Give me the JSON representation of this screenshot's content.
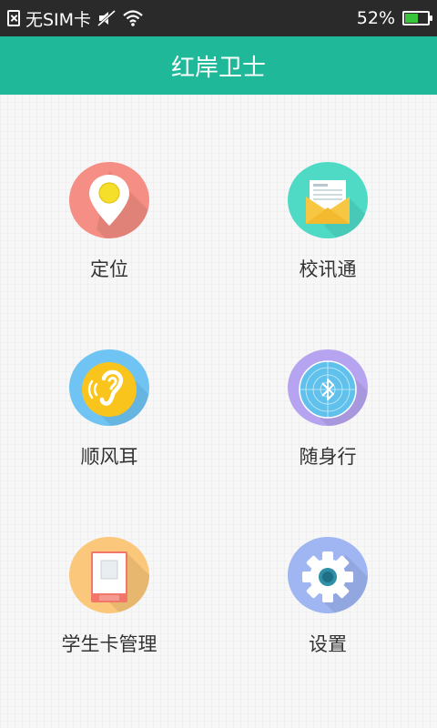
{
  "status_bar": {
    "carrier": "无SIM卡",
    "battery_percent": "52%",
    "battery_level": 0.52
  },
  "header": {
    "title": "红岸卫士"
  },
  "menu": [
    {
      "id": "location",
      "label": "定位",
      "color": "#f58e84",
      "icon": "location-pin-icon"
    },
    {
      "id": "school-messages",
      "label": "校讯通",
      "color": "#4fdac6",
      "icon": "envelope-icon"
    },
    {
      "id": "listen",
      "label": "顺风耳",
      "color": "#6fc4f4",
      "icon": "ear-icon"
    },
    {
      "id": "tracking",
      "label": "随身行",
      "color": "#b7a4f0",
      "icon": "bluetooth-radar-icon"
    },
    {
      "id": "student-card",
      "label": "学生卡管理",
      "color": "#fbc77a",
      "icon": "student-card-icon"
    },
    {
      "id": "settings",
      "label": "设置",
      "color": "#9fb6f3",
      "icon": "gear-icon"
    }
  ]
}
